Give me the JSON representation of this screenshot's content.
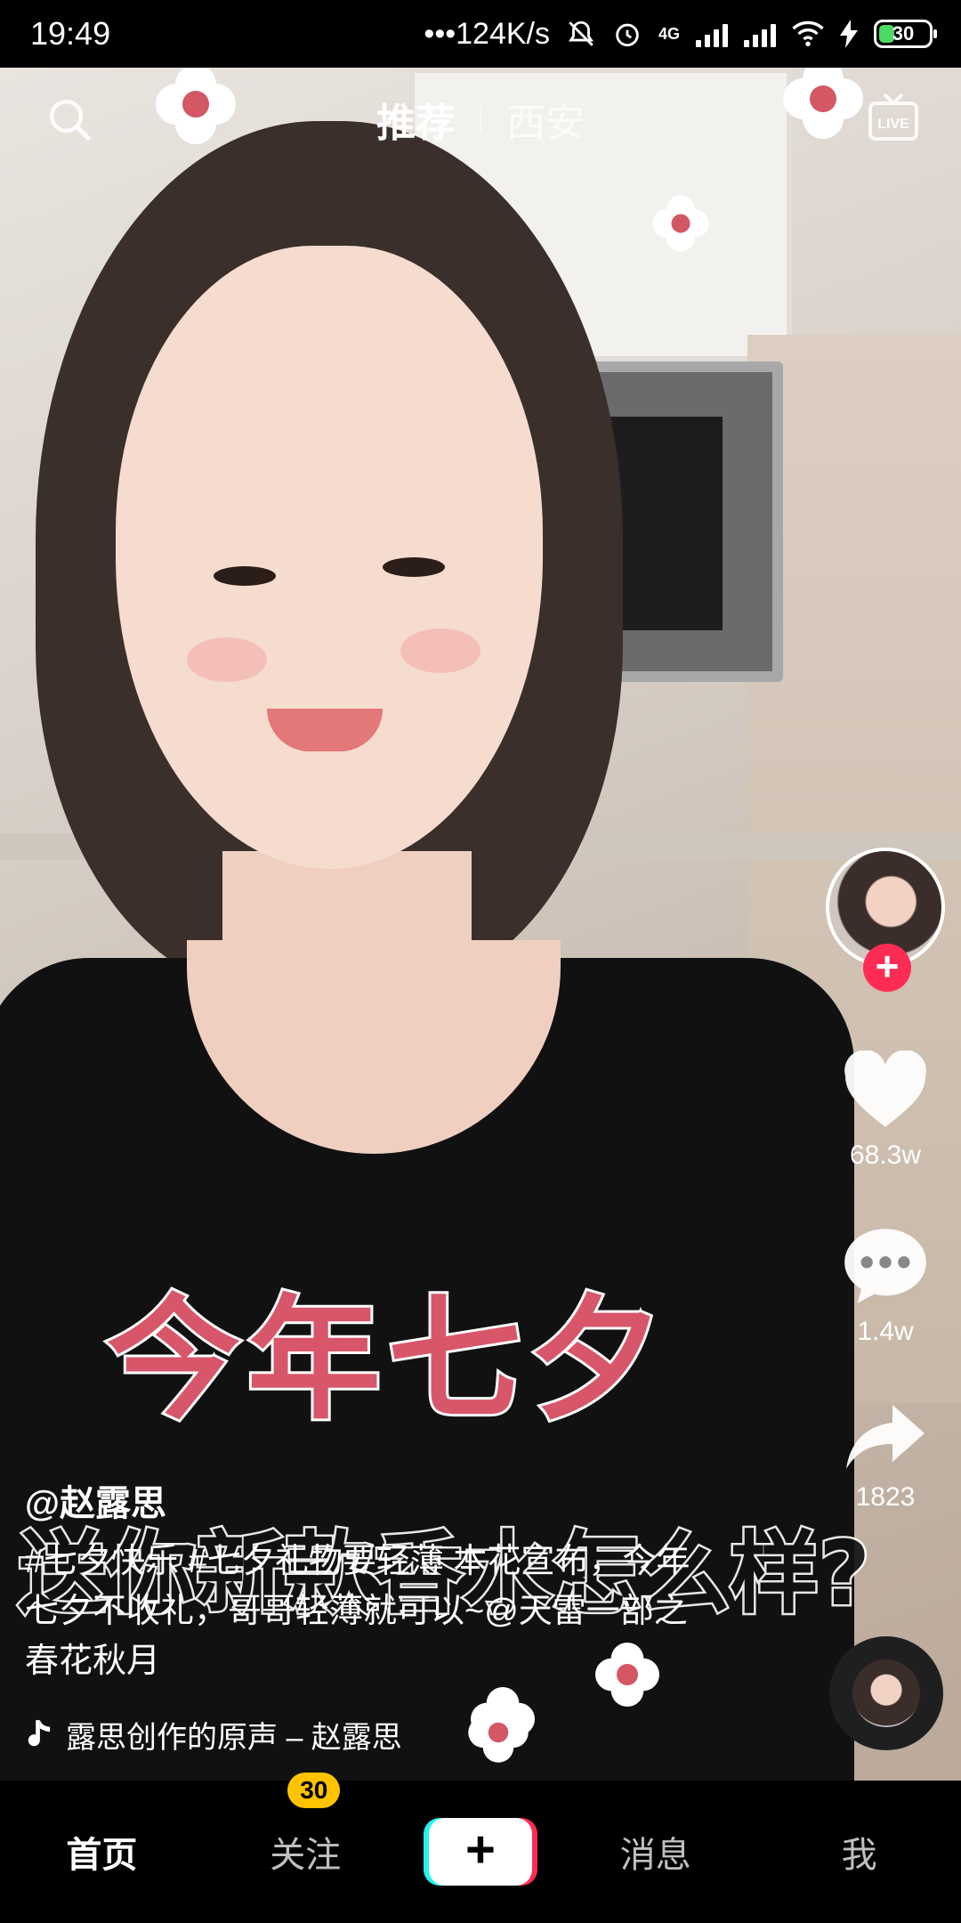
{
  "status_bar": {
    "time": "19:49",
    "net_speed": "•••124K/s",
    "network_label": "4G",
    "battery": "30"
  },
  "top_nav": {
    "tabs": [
      {
        "label": "推荐",
        "active": true
      },
      {
        "label": "西安",
        "active": false
      }
    ],
    "icons": {
      "left": "search-icon",
      "right": "live-icon"
    },
    "live_text": "LIVE"
  },
  "video": {
    "overlay_title": "今年七夕",
    "overlay_subtitle": "送你新款香水怎么样?"
  },
  "actions": {
    "follow_symbol": "+",
    "likes": "68.3w",
    "comments": "1.4w",
    "shares": "1823"
  },
  "post": {
    "author": "@赵露思",
    "description": "#七夕快乐 #七夕礼物要轻薄 本花宣布，今年七夕不收礼，哥哥轻薄就可以~@天雷一部之春花秋月",
    "music": "露思创作的原声 – 赵露思"
  },
  "tab_bar": {
    "items": [
      {
        "label": "首页",
        "active": true
      },
      {
        "label": "关注",
        "badge": "30"
      },
      {
        "label": "+",
        "type": "create"
      },
      {
        "label": "消息"
      },
      {
        "label": "我"
      }
    ]
  },
  "colors": {
    "accent": "#fe2c55",
    "cyan": "#25f4ee",
    "badge": "#ffc300",
    "caption": "#d8566a"
  }
}
